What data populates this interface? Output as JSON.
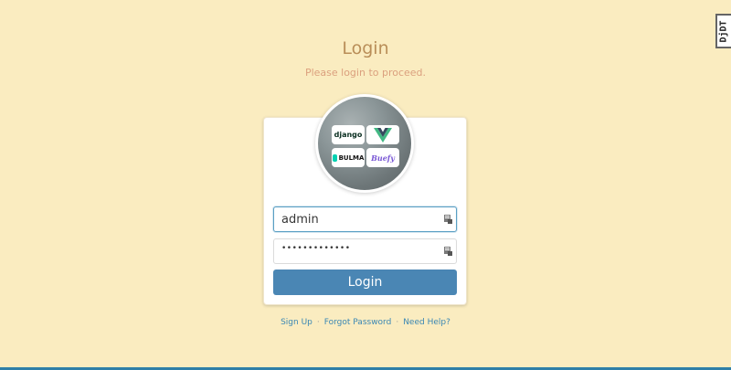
{
  "page": {
    "title": "Login",
    "subtitle": "Please login to proceed."
  },
  "avatar": {
    "logos": [
      "django",
      "vue",
      "BULMA",
      "Buefy"
    ]
  },
  "form": {
    "username_value": "admin",
    "password_masked": "•••••••••••••",
    "submit_label": "Login"
  },
  "footer": {
    "sign_up": "Sign Up",
    "forgot_password": "Forgot Password",
    "need_help": "Need Help?",
    "separator": "·"
  },
  "debug_toolbar": {
    "label": "DjDT"
  },
  "colors": {
    "background": "#faecc0",
    "button": "#4a86b4",
    "title": "#b98e58",
    "subtitle": "#dba07e",
    "link": "#3a87b4"
  }
}
